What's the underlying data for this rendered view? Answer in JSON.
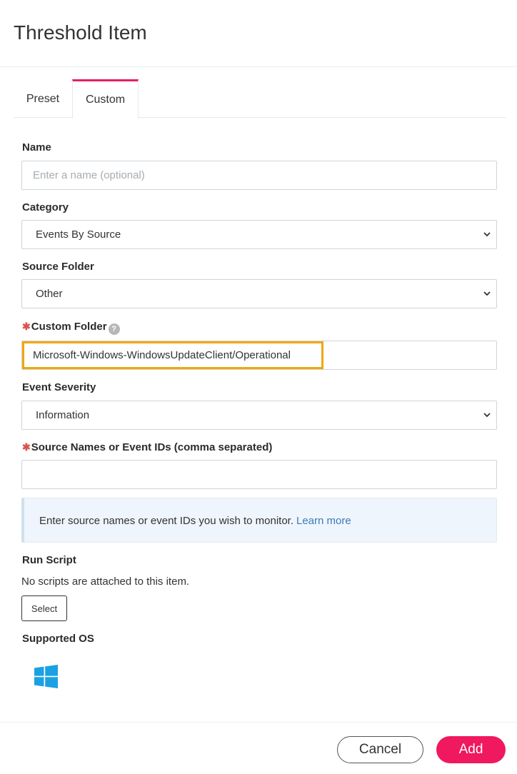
{
  "dialog": {
    "title": "Threshold Item"
  },
  "tabs": [
    {
      "label": "Preset",
      "active": false
    },
    {
      "label": "Custom",
      "active": true
    }
  ],
  "form": {
    "name": {
      "label": "Name",
      "value": "",
      "placeholder": "Enter a name (optional)"
    },
    "category": {
      "label": "Category",
      "value": "Events By Source"
    },
    "source_folder": {
      "label": "Source Folder",
      "value": "Other"
    },
    "custom_folder": {
      "required_mark": "✱",
      "label": "Custom Folder",
      "help_icon": "question-circle-icon",
      "value": "Microsoft-Windows-WindowsUpdateClient/Operational"
    },
    "event_severity": {
      "label": "Event Severity",
      "value": "Information"
    },
    "source_names": {
      "required_mark": "✱",
      "label": "Source Names or Event IDs (comma separated)",
      "value": ""
    }
  },
  "info": {
    "text": "Enter source names or event IDs you wish to monitor.",
    "link": "Learn more"
  },
  "run_script": {
    "label": "Run Script",
    "text": "No scripts are attached to this item.",
    "button": "Select"
  },
  "supported_os": {
    "label": "Supported OS",
    "icon": "windows-icon",
    "icon_color": "#1ba1e2"
  },
  "footer": {
    "cancel": "Cancel",
    "add": "Add"
  },
  "colors": {
    "accent": "#f0185e",
    "highlight": "#f0a70a",
    "required": "#d9534f",
    "link": "#3d7ab8"
  }
}
